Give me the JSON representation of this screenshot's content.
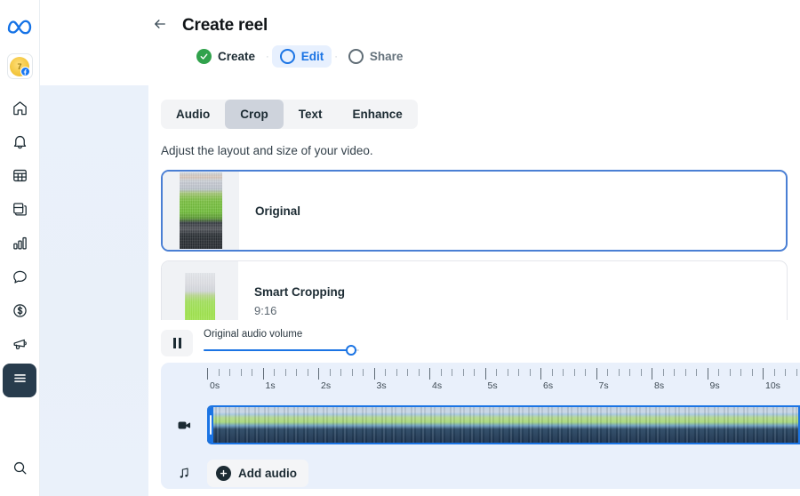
{
  "rail": {
    "logo_icon": "meta-logo-icon",
    "avatar": {
      "name": "avatar",
      "initial": "7",
      "badge_icon": "facebook-badge-icon"
    },
    "items": [
      {
        "icon": "home-icon",
        "name": "home"
      },
      {
        "icon": "bell-icon",
        "name": "notifications"
      },
      {
        "icon": "table-icon",
        "name": "table"
      },
      {
        "icon": "pages-icon",
        "name": "pages"
      },
      {
        "icon": "bar-chart-icon",
        "name": "insights"
      },
      {
        "icon": "chat-bubble-icon",
        "name": "messages"
      },
      {
        "icon": "dollar-circle-icon",
        "name": "monetization"
      },
      {
        "icon": "megaphone-icon",
        "name": "ads"
      },
      {
        "icon": "hamburger-menu-icon",
        "name": "all-tools",
        "active": true
      }
    ],
    "bottom": {
      "icon": "search-icon",
      "name": "search"
    }
  },
  "header": {
    "back_icon": "back-arrow-icon",
    "title": "Create reel",
    "steps": [
      {
        "label": "Create",
        "state": "done"
      },
      {
        "label": "Edit",
        "state": "active"
      },
      {
        "label": "Share",
        "state": "todo"
      }
    ],
    "separator": "·"
  },
  "editor": {
    "tabs": [
      {
        "label": "Audio",
        "selected": false
      },
      {
        "label": "Crop",
        "selected": true
      },
      {
        "label": "Text",
        "selected": false
      },
      {
        "label": "Enhance",
        "selected": false
      }
    ],
    "helper_text": "Adjust the layout and size of your video.",
    "crop_options": [
      {
        "title": "Original",
        "subtitle": "",
        "selected": true
      },
      {
        "title": "Smart Cropping",
        "subtitle": "9:16",
        "selected": false
      }
    ]
  },
  "dock": {
    "pause_icon": "pause-icon",
    "volume": {
      "label": "Original audio volume",
      "percent": 95
    },
    "ruler": {
      "labels": [
        "0s",
        "1s",
        "2s",
        "3s",
        "4s",
        "5s",
        "6s",
        "7s",
        "8s",
        "9s",
        "10s"
      ],
      "minor_per_major": 4
    },
    "tracks": [
      {
        "icon": "video-camera-icon",
        "name": "video-track"
      },
      {
        "icon": "music-note-icon",
        "name": "audio-track"
      }
    ],
    "add_audio": {
      "label": "Add audio",
      "icon": "plus-circle-icon"
    }
  },
  "colors": {
    "accent_blue": "#1b74e4",
    "done_green": "#31a24c",
    "rail_active": "#283c4d",
    "panel_bg": "#e9f0fb"
  }
}
